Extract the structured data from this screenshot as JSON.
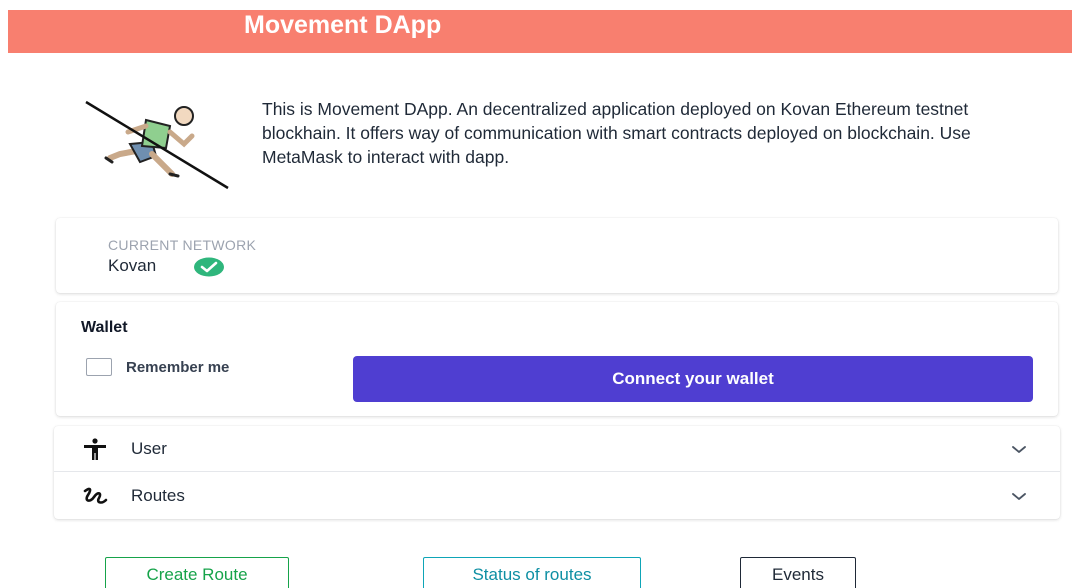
{
  "header": {
    "title": "Movement DApp"
  },
  "intro": {
    "icon": "running-person-crossed-icon",
    "text": "This is Movement DApp. An decentralized application deployed on Kovan Ethereum testnet blockhain. It offers way of communication with smart contracts deployed on blockchain. Use MetaMask to interact with dapp."
  },
  "network": {
    "label": "CURRENT NETWORK",
    "name": "Kovan",
    "status_icon": "check-circle-icon",
    "status_color": "#2fb67c"
  },
  "wallet": {
    "title": "Wallet",
    "remember_label": "Remember me",
    "remember_checked": false,
    "connect_label": "Connect your wallet",
    "connect_color": "#4f3ed1"
  },
  "accordion": {
    "items": [
      {
        "label": "User",
        "icon": "person-icon"
      },
      {
        "label": "Routes",
        "icon": "route-icon"
      }
    ]
  },
  "actions": {
    "create_route": "Create Route",
    "status_of_routes": "Status of routes",
    "events": "Events"
  },
  "colors": {
    "header_bg": "#f87f6f",
    "create_route": "#16a34a",
    "status_of_routes": "#0ea5b7",
    "events": "#1f2937"
  }
}
